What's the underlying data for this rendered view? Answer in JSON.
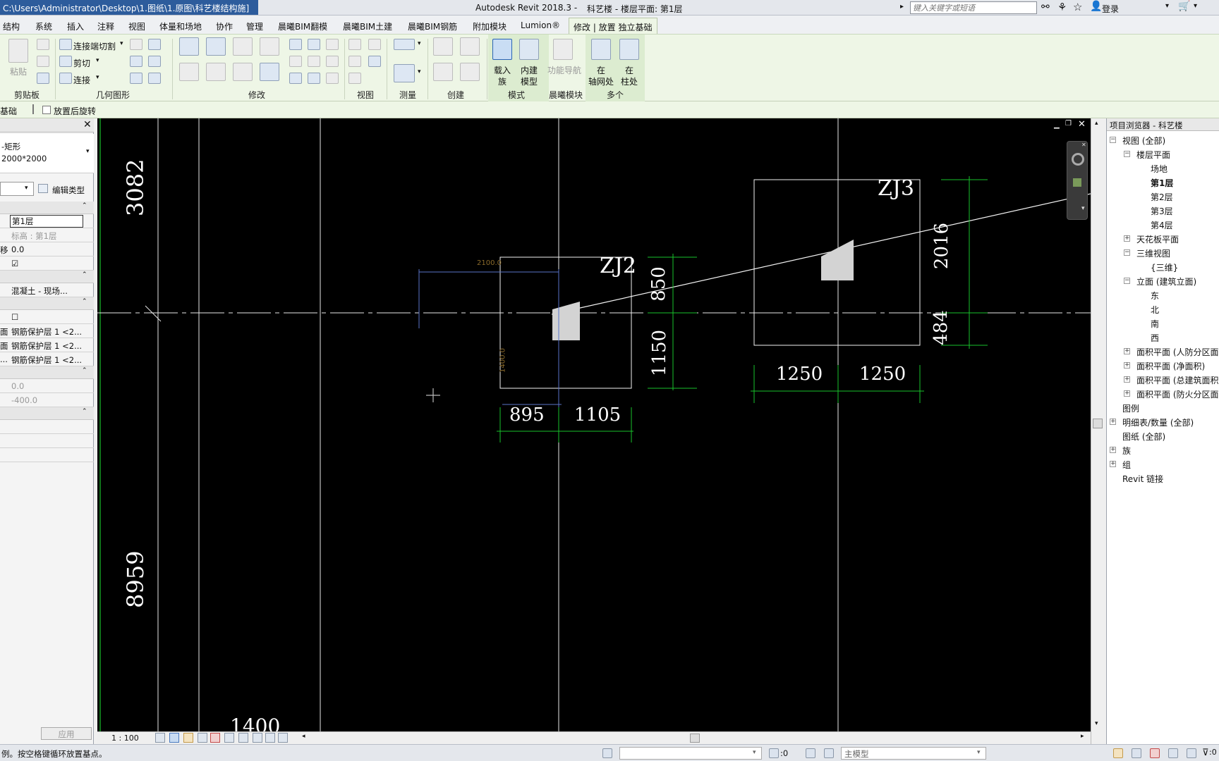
{
  "titlebar": {
    "path": "C:\\Users\\Administrator\\Desktop\\1.图纸\\1.原图\\科艺楼结构施]",
    "app_title": "Autodesk Revit 2018.3 -",
    "doc_title": "科艺楼 - 楼层平面: 第1层",
    "search_placeholder": "键入关键字或短语",
    "login": "登录"
  },
  "tabs": [
    "结构",
    "系统",
    "插入",
    "注释",
    "视图",
    "体量和场地",
    "协作",
    "管理",
    "晨曦BIM翻模",
    "晨曦BIM土建",
    "晨曦BIM钢筋",
    "附加模块",
    "Lumion®",
    "修改 | 放置 独立基础"
  ],
  "ribbon": {
    "paste": "粘贴",
    "cut_join": "连接端切割",
    "cut": "剪切",
    "join": "连接",
    "load_family_1": "载入",
    "load_family_2": "族",
    "inplace_1": "内建",
    "inplace_2": "模型",
    "func_nav": "功能导航",
    "at_grid_1": "在",
    "at_grid_2": "轴网处",
    "at_col_1": "在",
    "at_col_2": "柱处",
    "groups": [
      "剪贴板",
      "几何图形",
      "修改",
      "视图",
      "测量",
      "创建",
      "模式",
      "晨曦模块",
      "多个"
    ]
  },
  "options": {
    "context": "基础",
    "rotate_after": "放置后旋转"
  },
  "properties": {
    "type_line1": "-矩形",
    "type_line2": "2000*2000",
    "edit_type": "编辑类型",
    "rows": [
      {
        "label": "",
        "value": "第1层"
      },
      {
        "label": "",
        "value": "标高 : 第1层"
      },
      {
        "label": "移",
        "value": "0.0"
      },
      {
        "label": "",
        "value": "☑"
      },
      {
        "label": "",
        "value": "混凝土 - 现场..."
      },
      {
        "label": "",
        "value": "☐"
      },
      {
        "label": "面",
        "value": "钢筋保护层 1 <2..."
      },
      {
        "label": "面",
        "value": "钢筋保护层 1 <2..."
      },
      {
        "label": "...",
        "value": "钢筋保护层 1 <2..."
      },
      {
        "label": "",
        "value": "0.0"
      },
      {
        "label": "",
        "value": "-400.0"
      }
    ],
    "apply": "应用"
  },
  "canvas": {
    "dims": {
      "d3082": "3082",
      "d8959": "8959",
      "d1400": "1400",
      "d2100": "2100.0",
      "d1400v": "1400.0",
      "zj2": "ZJ2",
      "zj3": "ZJ3",
      "d850": "850",
      "d1150": "1150",
      "d895": "895",
      "d1105": "1105",
      "d2016": "2016",
      "d484": "484",
      "d1250a": "1250",
      "d1250b": "1250"
    },
    "scale": "1 : 100"
  },
  "browser": {
    "title": "项目浏览器 - 科艺楼",
    "nodes": [
      {
        "label": "视图 (全部)",
        "level": 0,
        "toggle": "−"
      },
      {
        "label": "楼层平面",
        "level": 1,
        "toggle": "−"
      },
      {
        "label": "场地",
        "level": 2,
        "toggle": ""
      },
      {
        "label": "第1层",
        "level": 2,
        "toggle": "",
        "bold": true
      },
      {
        "label": "第2层",
        "level": 2,
        "toggle": ""
      },
      {
        "label": "第3层",
        "level": 2,
        "toggle": ""
      },
      {
        "label": "第4层",
        "level": 2,
        "toggle": ""
      },
      {
        "label": "天花板平面",
        "level": 1,
        "toggle": "+"
      },
      {
        "label": "三维视图",
        "level": 1,
        "toggle": "−"
      },
      {
        "label": "{三维}",
        "level": 2,
        "toggle": ""
      },
      {
        "label": "立面 (建筑立面)",
        "level": 1,
        "toggle": "−"
      },
      {
        "label": "东",
        "level": 2,
        "toggle": ""
      },
      {
        "label": "北",
        "level": 2,
        "toggle": ""
      },
      {
        "label": "南",
        "level": 2,
        "toggle": ""
      },
      {
        "label": "西",
        "level": 2,
        "toggle": ""
      },
      {
        "label": "面积平面 (人防分区面",
        "level": 1,
        "toggle": "+"
      },
      {
        "label": "面积平面 (净面积)",
        "level": 1,
        "toggle": "+"
      },
      {
        "label": "面积平面 (总建筑面积",
        "level": 1,
        "toggle": "+"
      },
      {
        "label": "面积平面 (防火分区面",
        "level": 1,
        "toggle": "+"
      },
      {
        "label": "图例",
        "level": 0,
        "toggle": ""
      },
      {
        "label": "明细表/数量 (全部)",
        "level": 0,
        "toggle": "+"
      },
      {
        "label": "图纸 (全部)",
        "level": 0,
        "toggle": ""
      },
      {
        "label": "族",
        "level": 0,
        "toggle": "+"
      },
      {
        "label": "组",
        "level": 0,
        "toggle": "+"
      },
      {
        "label": "Revit 链接",
        "level": 0,
        "toggle": ""
      }
    ]
  },
  "status": {
    "message": "例。按空格键循环放置基点。",
    "zero": ":0",
    "model": "主模型"
  }
}
